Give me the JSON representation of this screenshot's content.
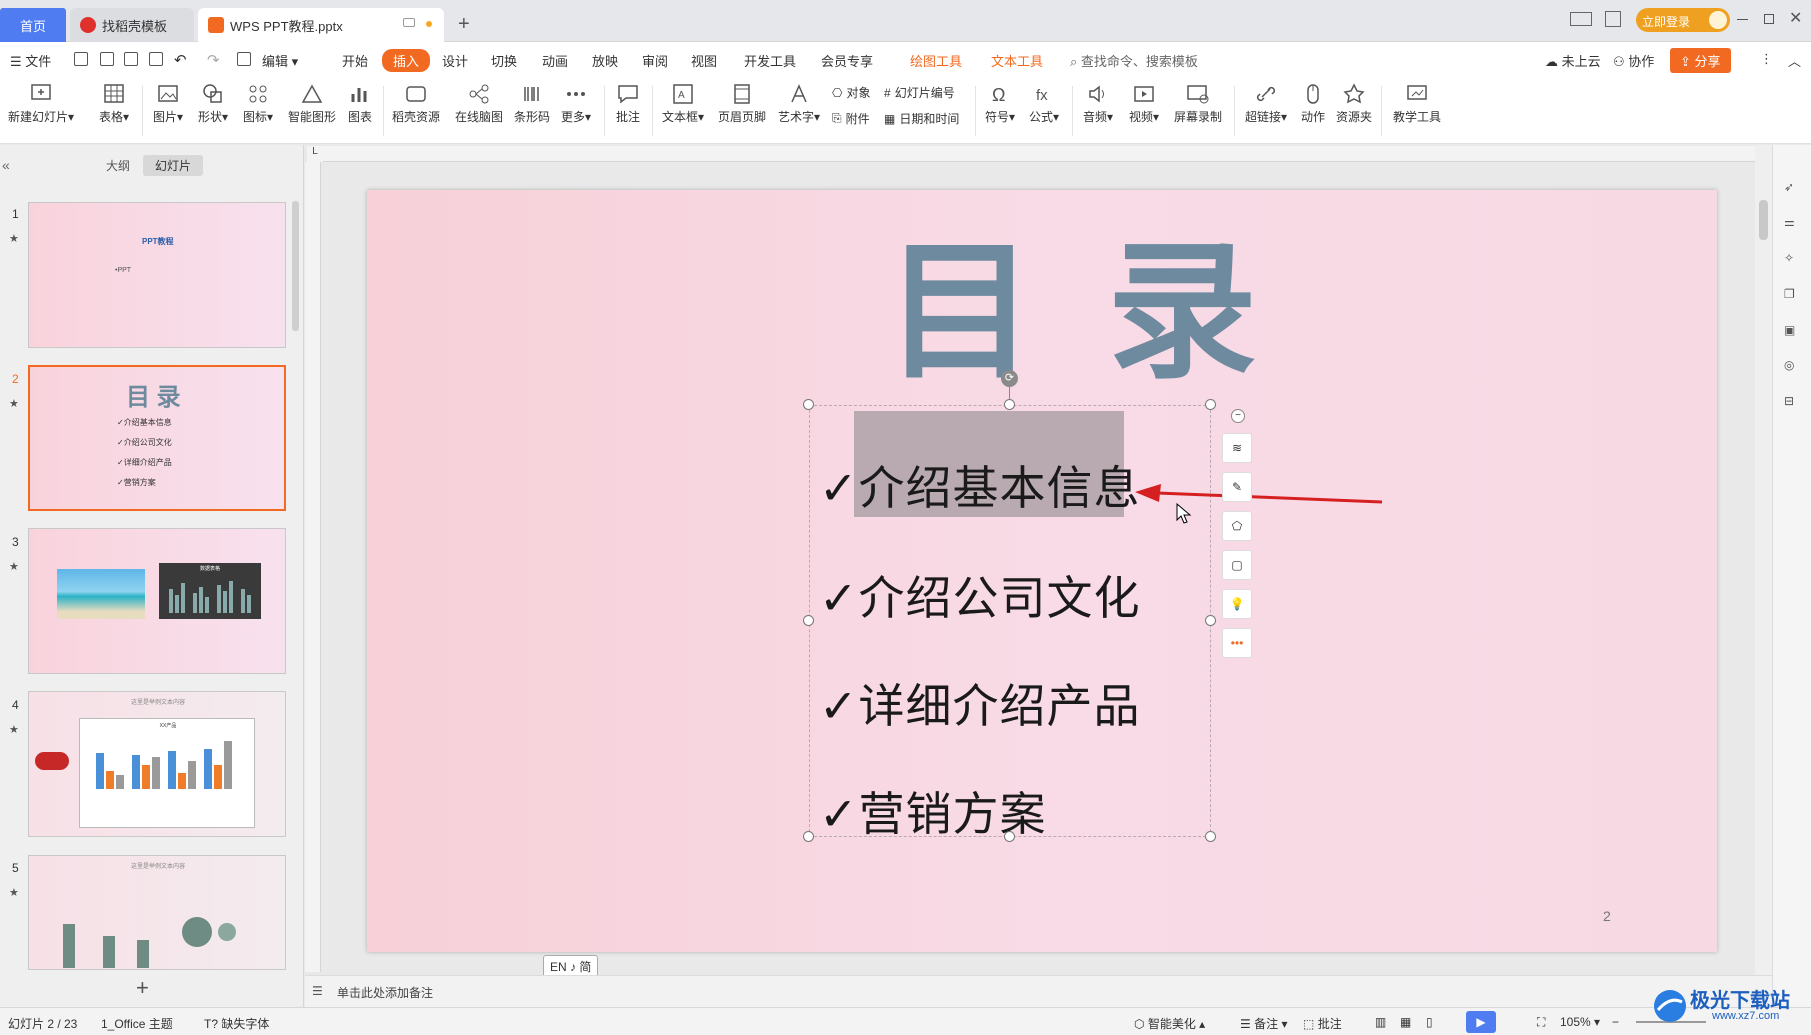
{
  "window": {
    "tabs": [
      {
        "label": "首页"
      },
      {
        "label": "找稻壳模板"
      },
      {
        "label": "WPS PPT教程.pptx"
      }
    ],
    "login_label": "立即登录",
    "accent": "#4f7cf0"
  },
  "menu": {
    "file": "文件",
    "edit": "编辑",
    "items": [
      "开始",
      "插入",
      "设计",
      "切换",
      "动画",
      "放映",
      "审阅",
      "视图",
      "开发工具",
      "会员专享"
    ],
    "context_draw": "绘图工具",
    "context_text": "文本工具",
    "search_placeholder": "查找命令、搜索模板",
    "cloud": "未上云",
    "collab": "协作",
    "share": "分享"
  },
  "ribbon": {
    "new_slide": "新建幻灯片",
    "table": "表格",
    "picture": "图片",
    "shape": "形状",
    "icon": "图标",
    "smartart": "智能图形",
    "chart": "图表",
    "resources": "稻壳资源",
    "mindmap": "在线脑图",
    "barcode": "条形码",
    "more": "更多",
    "comment": "批注",
    "textbox": "文本框",
    "header_footer": "页眉页脚",
    "wordart": "艺术字",
    "object": "对象",
    "attachment": "附件",
    "slide_number": "幻灯片编号",
    "datetime": "日期和时间",
    "symbol": "符号",
    "formula": "公式",
    "audio": "音频",
    "video": "视频",
    "screen_record": "屏幕录制",
    "hyperlink": "超链接",
    "action": "动作",
    "resource_folder": "资源夹",
    "teach_tools": "教学工具"
  },
  "left_panel": {
    "tab_outline": "大纲",
    "tab_slides": "幻灯片",
    "thumbs": [
      {
        "num": "1",
        "title": "PPT教程",
        "line": "•PPT"
      },
      {
        "num": "2",
        "title": "目 录",
        "items": [
          "✓介绍基本信息",
          "✓介绍公司文化",
          "✓详细介绍产品",
          "✓营销方案"
        ]
      },
      {
        "num": "3",
        "caption": "数据表格"
      },
      {
        "num": "4",
        "caption": "这里是举例文本内容",
        "chart_title": "XX产品"
      },
      {
        "num": "5",
        "caption": "这里是举例文本内容"
      }
    ],
    "add_label": "+"
  },
  "slide": {
    "title": "目 录",
    "bullets": [
      "✓介绍基本信息",
      "✓介绍公司文化",
      "✓详细介绍产品",
      "✓营销方案"
    ],
    "page_number": "2"
  },
  "ime": "EN ♪ 简",
  "notes_placeholder": "单击此处添加备注",
  "status": {
    "slide_info": "幻灯片 2 / 23",
    "theme": "1_Office 主题",
    "missing_font": "缺失字体",
    "beautify": "智能美化",
    "notes": "备注",
    "comments": "批注",
    "zoom": "105%"
  },
  "watermark": {
    "text": "极光下载站",
    "url": "www.xz7.com"
  }
}
